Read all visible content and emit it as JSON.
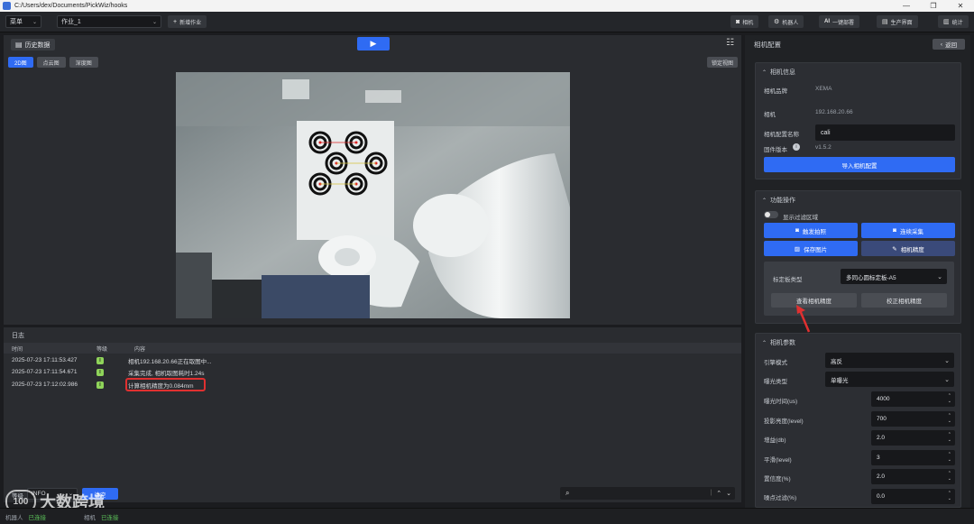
{
  "window": {
    "title": "C:/Users/dex/Documents/PickWiz/hooks",
    "minimize": "—",
    "maximize": "❐",
    "close": "✕"
  },
  "toolbar": {
    "menu_label": "菜单",
    "job_select": "作业_1",
    "new_job": "新增作业",
    "buttons": [
      {
        "label": "相机",
        "icon": "camera-icon"
      },
      {
        "label": "机器人",
        "icon": "robot-icon"
      },
      {
        "label": "一键部署",
        "icon": "ai-icon"
      },
      {
        "label": "生产界面",
        "icon": "production-icon"
      },
      {
        "label": "统计",
        "icon": "stats-icon"
      }
    ]
  },
  "left": {
    "history_label": "历史数据",
    "view_tabs": [
      "2D图",
      "点云图",
      "深度图"
    ],
    "active_tab": "2D图",
    "lock_view": "锁定视图"
  },
  "log": {
    "title": "日志",
    "columns": {
      "time": "时间",
      "level": "等级",
      "content": "内容"
    },
    "rows": [
      {
        "time": "2025-07-23 17:11:53.427",
        "level": "I",
        "content": "相机192.168.20.66正在取图中..."
      },
      {
        "time": "2025-07-23 17:11:54.671",
        "level": "I",
        "content": "采集完成, 相机取图耗时1.24s"
      },
      {
        "time": "2025-07-23 17:12:02.986",
        "level": "I",
        "content": "计算相机精度为0.084mm"
      }
    ],
    "level_filter_label": "等级",
    "level_filter_value": "INFO",
    "clear_label": "清空",
    "search_placeholder": ""
  },
  "status": {
    "left_label": "机器人",
    "left_value": "已连接",
    "right_label": "相机",
    "right_value": "已连接"
  },
  "watermark": {
    "logo_text": "100",
    "text": "大数跨境"
  },
  "right": {
    "panel_title": "相机配置",
    "back_label": "返回",
    "camera_info": {
      "title": "相机信息",
      "brand_label": "相机品牌",
      "brand_value": "XEMA",
      "camera_label": "相机",
      "camera_value": "192.168.20.66",
      "config_name_label": "相机配置名称",
      "config_name_value": "cali",
      "firmware_label": "固件版本",
      "firmware_value": "v1.5.2",
      "import_label": "导入相机配置"
    },
    "operations": {
      "title": "功能操作",
      "show_filter_label": "显示过滤区域",
      "trigger_label": "触发拍照",
      "continuous_label": "连续采集",
      "save_image_label": "保存图片",
      "accuracy_label": "相机精度",
      "board_type_label": "标定板类型",
      "board_type_value": "多同心圆标定板-A5",
      "check_accuracy_label": "查看相机精度",
      "calibrate_accuracy_label": "校正相机精度"
    },
    "params": {
      "title": "相机参数",
      "engine_mode_label": "引擎模式",
      "engine_mode_value": "高反",
      "exposure_type_label": "曝光类型",
      "exposure_type_value": "单曝光",
      "exposure_time_label": "曝光时间(us)",
      "exposure_time_value": "4000",
      "projector_label": "投影亮度(level)",
      "projector_value": "700",
      "gain_label": "增益(db)",
      "gain_value": "2.0",
      "smooth_label": "平滑(level)",
      "smooth_value": "3",
      "confidence_label": "置信度(%)",
      "confidence_value": "2.0",
      "noise_label": "噪点过滤(%)",
      "noise_value": "0.0"
    }
  },
  "colors": {
    "accent": "#2f6bf3",
    "highlight": "#e03030",
    "ok": "#5cc25a"
  }
}
